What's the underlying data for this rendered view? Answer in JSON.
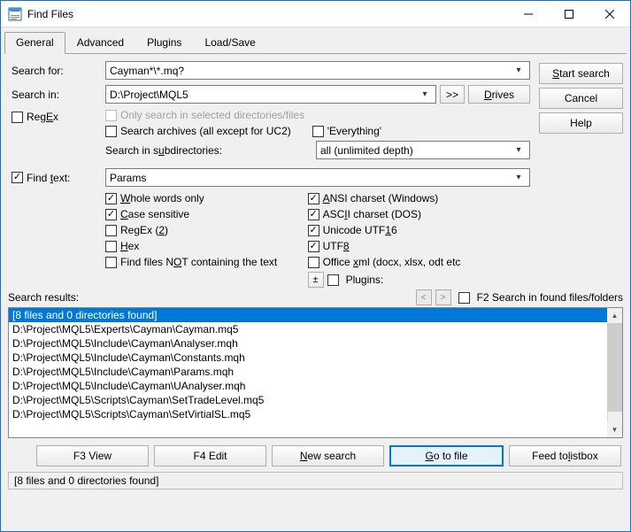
{
  "window": {
    "title": "Find Files"
  },
  "tabs": [
    "General",
    "Advanced",
    "Plugins",
    "Load/Save"
  ],
  "sidebar": {
    "start": "Start search",
    "cancel": "Cancel",
    "help": "Help"
  },
  "searchFor": {
    "label": "Search for:",
    "value": "Cayman*\\*.mq?"
  },
  "searchIn": {
    "label": "Search in:",
    "value": "D:\\Project\\MQL5",
    "expand": ">>",
    "drives": "Drives"
  },
  "regex": {
    "label": "RegEx",
    "checked": false
  },
  "opt": {
    "onlySelected": "Only search in selected directories/files",
    "archives": "Search archives (all except for UC2)",
    "everything": "'Everything'",
    "subdirs": "Search in subdirectories:",
    "subdirsVal": "all (unlimited depth)"
  },
  "findText": {
    "label": "Find text:",
    "checked": true,
    "value": "Params"
  },
  "left": {
    "whole": "Whole words only",
    "case": "Case sensitive",
    "regex2": "RegEx (2)",
    "hex": "Hex",
    "notcontain": "Find files NOT containing the text"
  },
  "right": {
    "ansi": "ANSI charset (Windows)",
    "ascii": "ASCII charset (DOS)",
    "utf16": "Unicode UTF16",
    "utf8": "UTF8",
    "office": "Office xml (docx, xlsx, odt etc.)",
    "plugins": "Plugins:"
  },
  "resultsHdr": {
    "label": "Search results:",
    "f2": "F2 Search in found files/folders"
  },
  "results": [
    "[8 files and 0 directories found]",
    "D:\\Project\\MQL5\\Experts\\Cayman\\Cayman.mq5",
    "D:\\Project\\MQL5\\Include\\Cayman\\Analyser.mqh",
    "D:\\Project\\MQL5\\Include\\Cayman\\Constants.mqh",
    "D:\\Project\\MQL5\\Include\\Cayman\\Params.mqh",
    "D:\\Project\\MQL5\\Include\\Cayman\\UAnalyser.mqh",
    "D:\\Project\\MQL5\\Scripts\\Cayman\\SetTradeLevel.mq5",
    "D:\\Project\\MQL5\\Scripts\\Cayman\\SetVirtialSL.mq5"
  ],
  "bottom": {
    "view": "F3 View",
    "edit": "F4 Edit",
    "newsearch": "New search",
    "goto": "Go to file",
    "feed": "Feed to listbox"
  },
  "status": "[8 files and 0 directories found]"
}
